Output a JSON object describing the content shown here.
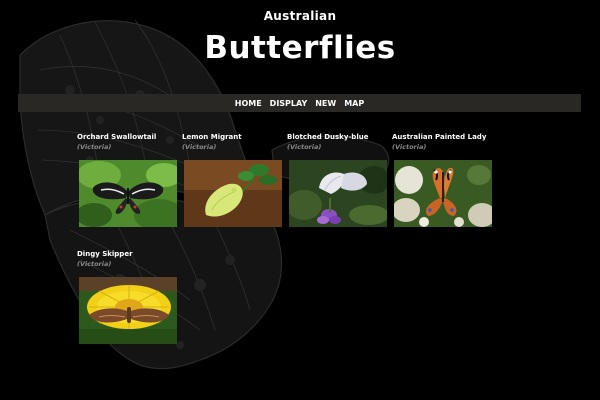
{
  "header": {
    "subtitle": "Australian",
    "title": "Butterflies"
  },
  "nav": {
    "items": [
      "HOME",
      "DISPLAY",
      "NEW",
      "MAP"
    ]
  },
  "gallery": [
    {
      "name": "Orchard Swallowtail",
      "region": "(Victoria)"
    },
    {
      "name": "Lemon Migrant",
      "region": "(Victoria)"
    },
    {
      "name": "Blotched Dusky-blue",
      "region": "(Victoria)"
    },
    {
      "name": "Australian Painted Lady",
      "region": "(Victoria)"
    },
    {
      "name": "Dingy Skipper",
      "region": "(Victoria)"
    }
  ]
}
